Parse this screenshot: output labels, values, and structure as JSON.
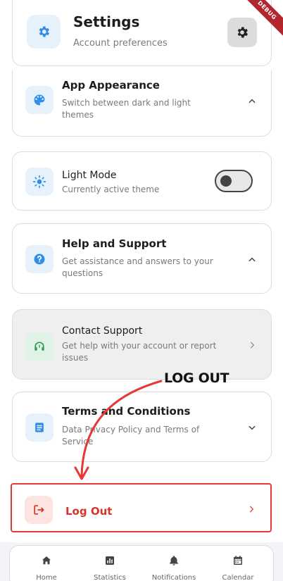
{
  "debug_banner": "DEBUG",
  "header": {
    "title": "Settings",
    "subtitle": "Account preferences"
  },
  "appearance": {
    "title": "App Appearance",
    "subtitle": "Switch between dark and light themes"
  },
  "light_mode": {
    "title": "Light Mode",
    "subtitle": "Currently active theme",
    "toggle_on": false
  },
  "help": {
    "title": "Help and Support",
    "subtitle": "Get assistance and answers to your questions"
  },
  "contact": {
    "title": "Contact Support",
    "subtitle": "Get help with your account or report issues"
  },
  "terms": {
    "title": "Terms and Conditions",
    "subtitle": "Data Privacy Policy and Terms of Service"
  },
  "logout": {
    "title": "Log Out"
  },
  "annotation": {
    "label": "LOG OUT"
  },
  "nav": {
    "items": [
      {
        "label": "Home",
        "icon": "home-icon"
      },
      {
        "label": "Statistics",
        "icon": "statistics-icon"
      },
      {
        "label": "Notifications",
        "icon": "bell-icon"
      },
      {
        "label": "Calendar",
        "icon": "calendar-icon"
      }
    ]
  },
  "colors": {
    "accent_blue": "#2f8fe6",
    "danger_red": "#e53935",
    "contact_green": "#2e9b5a"
  }
}
